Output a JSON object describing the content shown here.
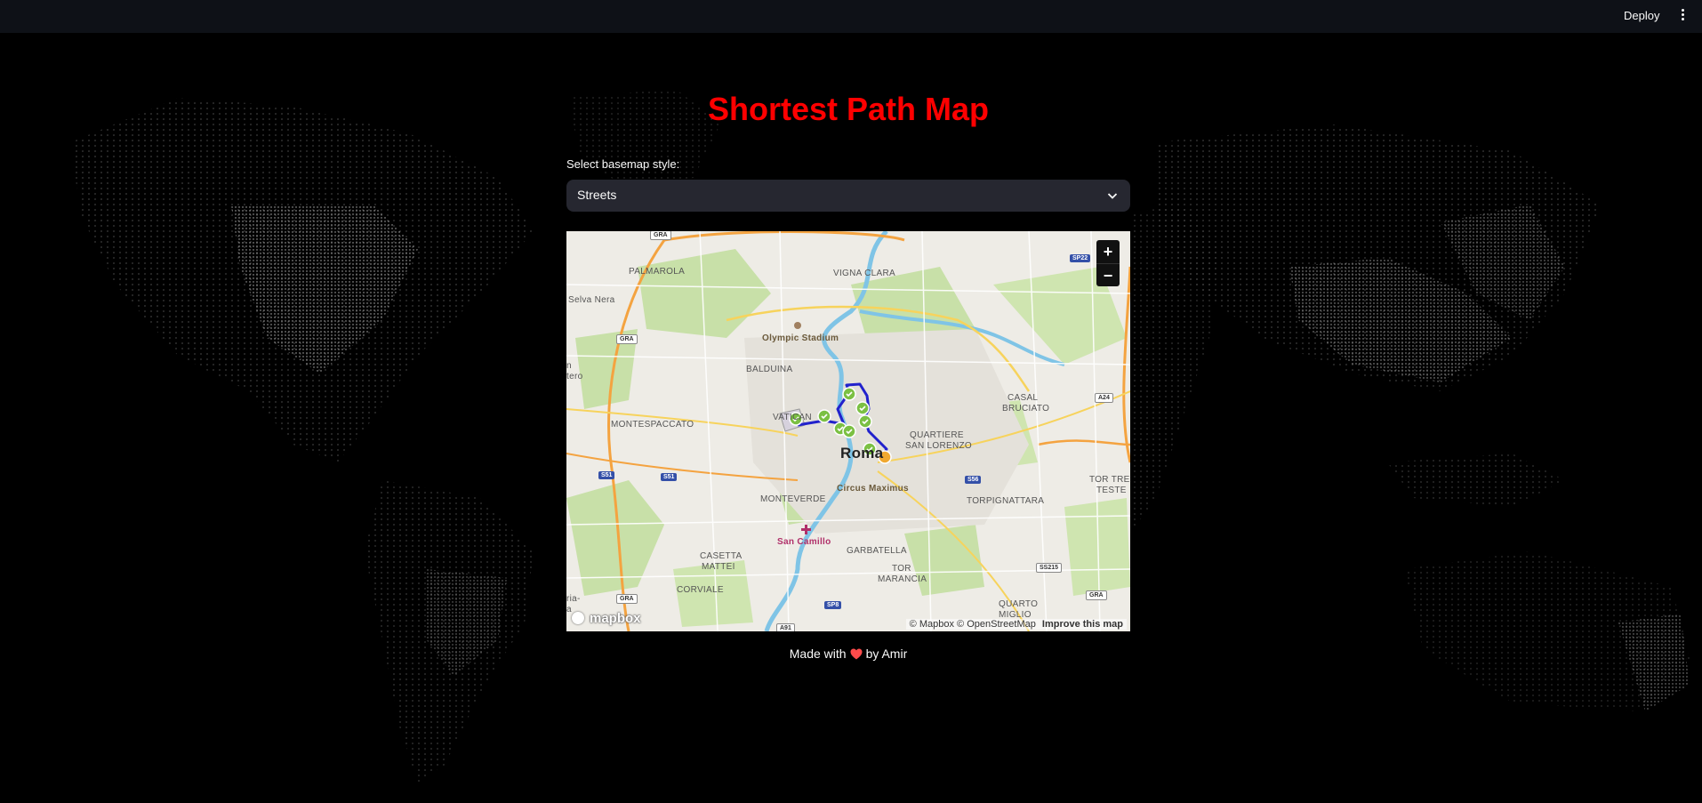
{
  "header": {
    "deploy_label": "Deploy",
    "menu_icon": "vertical-dots-icon"
  },
  "main": {
    "title": "Shortest Path Map",
    "title_color": "#ff0000",
    "select_label": "Select basemap style:",
    "select_value": "Streets"
  },
  "map": {
    "provider_logo": "mapbox",
    "zoom_in": "+",
    "zoom_out": "−",
    "attribution": {
      "mapbox": "© Mapbox",
      "osm": "© OpenStreetMap",
      "improve": "Improve this map"
    },
    "labels": {
      "selva_nera": "Selva Nera",
      "palmarola": "PALMAROLA",
      "vigna_clara": "VIGNA CLARA",
      "olympic_stadium": "Olympic Stadium",
      "balduina": "BALDUINA",
      "montespaccato": "MONTESPACCATO",
      "vatican": "VATICAN",
      "roma": "Roma",
      "circus_maximus": "Circus Maximus",
      "quartiere_san_lorenzo_1": "QUARTIERE",
      "quartiere_san_lorenzo_2": "SAN LORENZO",
      "casal_bruciato_1": "CASAL",
      "casal_bruciato_2": "BRUCIATO",
      "monteverde": "MONTEVERDE",
      "san_camillo": "San Camillo",
      "torpignattara": "TORPIGNATTARA",
      "tor_tre_teste_1": "TOR TRE",
      "tor_tre_teste_2": "TESTE",
      "casetta_mattei_1": "CASETTA",
      "casetta_mattei_2": "MATTEI",
      "garbatella": "GARBATELLA",
      "tor_marancia_1": "TOR",
      "tor_marancia_2": "MARANCIA",
      "corviale": "CORVIALE",
      "quarto_miglio_1": "QUARTO",
      "quarto_miglio_2": "MIGLIO",
      "n_tero": "n",
      "n_tero_2": "tero",
      "ria": "ria-",
      "ria_2": "a"
    },
    "shields": {
      "gra_top": "GRA",
      "gra_left": "GRA",
      "gra_bottom": "GRA",
      "gra_right": "GRA",
      "sp22": "SP22",
      "a24": "A24",
      "s51_a": "S51",
      "s51_b": "S51",
      "s56": "S56",
      "ss215": "SS215",
      "sp8": "SP8",
      "a91": "A91"
    },
    "route_color": "#2222cc",
    "waypoint_color": "#7bc043",
    "destination_color": "#f0a830"
  },
  "footer": {
    "made_with": "Made with",
    "by": "by Amir",
    "heart_icon": "heart-icon",
    "heart_color": "#ff4b4b"
  }
}
